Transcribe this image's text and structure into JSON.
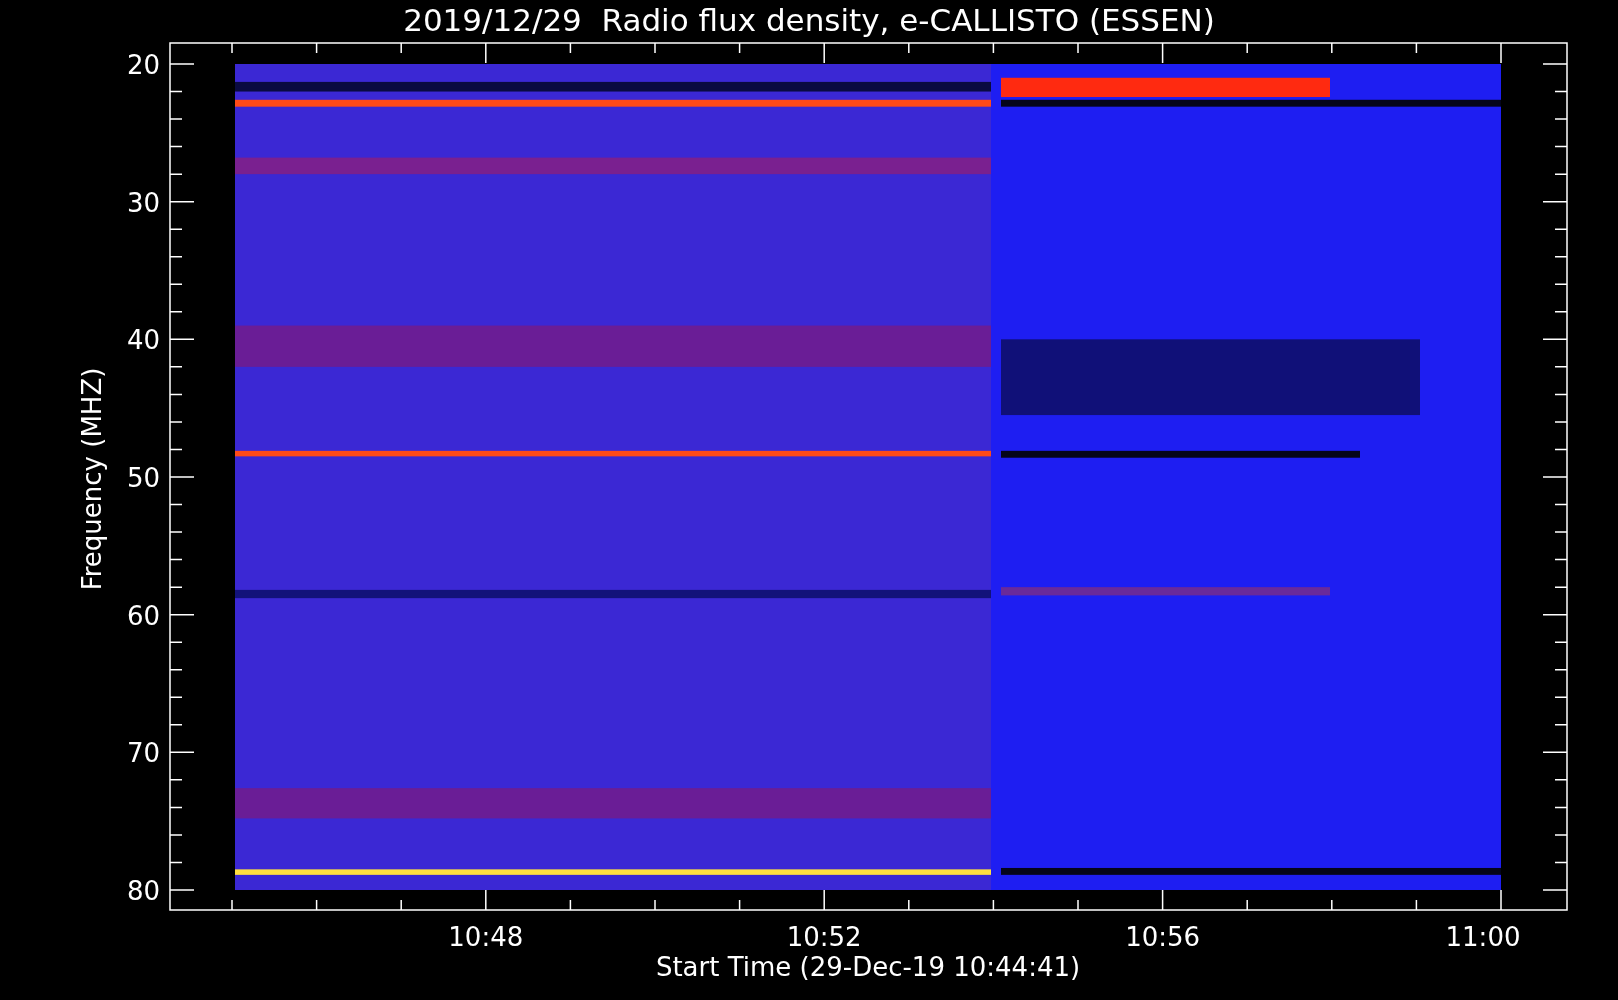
{
  "title": "2019/12/29  Radio flux density, e-CALLISTO (ESSEN)",
  "y_axis": {
    "label": "Frequency (MHZ)",
    "tick_labels": [
      "20",
      "30",
      "40",
      "50",
      "60",
      "70",
      "80"
    ]
  },
  "x_axis": {
    "label": "Start Time (29-Dec-19 10:44:41)",
    "tick_labels": [
      "10:48",
      "10:52",
      "10:56",
      "11:00"
    ]
  }
}
